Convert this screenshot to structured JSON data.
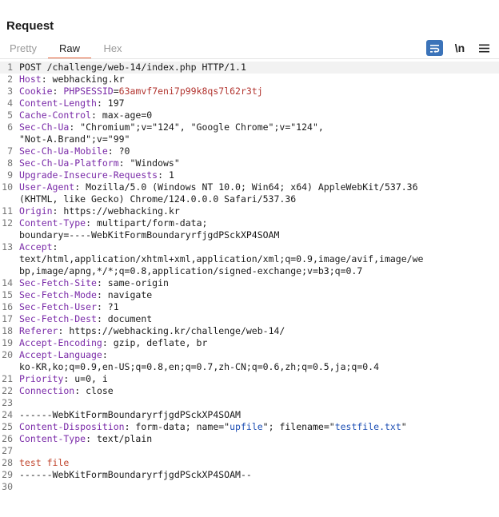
{
  "panel": {
    "title": "Request"
  },
  "tabs": [
    {
      "label": "Pretty",
      "active": false
    },
    {
      "label": "Raw",
      "active": true
    },
    {
      "label": "Hex",
      "active": false
    }
  ],
  "toolbar": {
    "newline_label": "\\n",
    "wrap_icon": "wrap-lines-icon",
    "menu_icon": "hamburger-menu-icon",
    "accent_color": "#3b73b9"
  },
  "colors": {
    "header_key": "#7a2aa8",
    "cookie_value": "#b2342f",
    "form_value": "#1e4fb4",
    "body_text": "#c1462e",
    "tab_underline": "#e8643a"
  },
  "editor": {
    "lines": [
      {
        "n": "1",
        "segs": [
          {
            "t": "POST /challenge/web-14/index.php HTTP/1.1",
            "k": "p"
          }
        ]
      },
      {
        "n": "2",
        "segs": [
          {
            "t": "Host",
            "k": "hk"
          },
          {
            "t": ": webhacking.kr",
            "k": "p"
          }
        ]
      },
      {
        "n": "3",
        "segs": [
          {
            "t": "Cookie",
            "k": "hk"
          },
          {
            "t": ": ",
            "k": "p"
          },
          {
            "t": "PHPSESSID",
            "k": "hk"
          },
          {
            "t": "=",
            "k": "p"
          },
          {
            "t": "63amvf7eni7p99k8qs7l62r3tj",
            "k": "rv"
          }
        ]
      },
      {
        "n": "4",
        "segs": [
          {
            "t": "Content-Length",
            "k": "hk"
          },
          {
            "t": ": 197",
            "k": "p"
          }
        ]
      },
      {
        "n": "5",
        "segs": [
          {
            "t": "Cache-Control",
            "k": "hk"
          },
          {
            "t": ": max-age=0",
            "k": "p"
          }
        ]
      },
      {
        "n": "6",
        "segs": [
          {
            "t": "Sec-Ch-Ua",
            "k": "hk"
          },
          {
            "t": ": \"Chromium\";v=\"124\", \"Google Chrome\";v=\"124\",",
            "k": "p"
          }
        ]
      },
      {
        "n": "",
        "segs": [
          {
            "t": "\"Not-A.Brand\";v=\"99\"",
            "k": "p"
          }
        ]
      },
      {
        "n": "7",
        "segs": [
          {
            "t": "Sec-Ch-Ua-Mobile",
            "k": "hk"
          },
          {
            "t": ": ?0",
            "k": "p"
          }
        ]
      },
      {
        "n": "8",
        "segs": [
          {
            "t": "Sec-Ch-Ua-Platform",
            "k": "hk"
          },
          {
            "t": ": \"Windows\"",
            "k": "p"
          }
        ]
      },
      {
        "n": "9",
        "segs": [
          {
            "t": "Upgrade-Insecure-Requests",
            "k": "hk"
          },
          {
            "t": ": 1",
            "k": "p"
          }
        ]
      },
      {
        "n": "10",
        "segs": [
          {
            "t": "User-Agent",
            "k": "hk"
          },
          {
            "t": ": Mozilla/5.0 (Windows NT 10.0; Win64; x64) AppleWebKit/537.36",
            "k": "p"
          }
        ]
      },
      {
        "n": "",
        "segs": [
          {
            "t": "(KHTML, like Gecko) Chrome/124.0.0.0 Safari/537.36",
            "k": "p"
          }
        ]
      },
      {
        "n": "11",
        "segs": [
          {
            "t": "Origin",
            "k": "hk"
          },
          {
            "t": ": https://webhacking.kr",
            "k": "p"
          }
        ]
      },
      {
        "n": "12",
        "segs": [
          {
            "t": "Content-Type",
            "k": "hk"
          },
          {
            "t": ": multipart/form-data;",
            "k": "p"
          }
        ]
      },
      {
        "n": "",
        "segs": [
          {
            "t": "boundary=----WebKitFormBoundaryrfjgdPSckXP4SOAM",
            "k": "p"
          }
        ]
      },
      {
        "n": "13",
        "segs": [
          {
            "t": "Accept",
            "k": "hk"
          },
          {
            "t": ":",
            "k": "p"
          }
        ]
      },
      {
        "n": "",
        "segs": [
          {
            "t": "text/html,application/xhtml+xml,application/xml;q=0.9,image/avif,image/we",
            "k": "p"
          }
        ]
      },
      {
        "n": "",
        "segs": [
          {
            "t": "bp,image/apng,*/*;q=0.8,application/signed-exchange;v=b3;q=0.7",
            "k": "p"
          }
        ]
      },
      {
        "n": "14",
        "segs": [
          {
            "t": "Sec-Fetch-Site",
            "k": "hk"
          },
          {
            "t": ": same-origin",
            "k": "p"
          }
        ]
      },
      {
        "n": "15",
        "segs": [
          {
            "t": "Sec-Fetch-Mode",
            "k": "hk"
          },
          {
            "t": ": navigate",
            "k": "p"
          }
        ]
      },
      {
        "n": "16",
        "segs": [
          {
            "t": "Sec-Fetch-User",
            "k": "hk"
          },
          {
            "t": ": ?1",
            "k": "p"
          }
        ]
      },
      {
        "n": "17",
        "segs": [
          {
            "t": "Sec-Fetch-Dest",
            "k": "hk"
          },
          {
            "t": ": document",
            "k": "p"
          }
        ]
      },
      {
        "n": "18",
        "segs": [
          {
            "t": "Referer",
            "k": "hk"
          },
          {
            "t": ": https://webhacking.kr/challenge/web-14/",
            "k": "p"
          }
        ]
      },
      {
        "n": "19",
        "segs": [
          {
            "t": "Accept-Encoding",
            "k": "hk"
          },
          {
            "t": ": gzip, deflate, br",
            "k": "p"
          }
        ]
      },
      {
        "n": "20",
        "segs": [
          {
            "t": "Accept-Language",
            "k": "hk"
          },
          {
            "t": ":",
            "k": "p"
          }
        ]
      },
      {
        "n": "",
        "segs": [
          {
            "t": "ko-KR,ko;q=0.9,en-US;q=0.8,en;q=0.7,zh-CN;q=0.6,zh;q=0.5,ja;q=0.4",
            "k": "p"
          }
        ]
      },
      {
        "n": "21",
        "segs": [
          {
            "t": "Priority",
            "k": "hk"
          },
          {
            "t": ": u=0, i",
            "k": "p"
          }
        ]
      },
      {
        "n": "22",
        "segs": [
          {
            "t": "Connection",
            "k": "hk"
          },
          {
            "t": ": close",
            "k": "p"
          }
        ]
      },
      {
        "n": "23",
        "segs": []
      },
      {
        "n": "24",
        "segs": [
          {
            "t": "------WebKitFormBoundaryrfjgdPSckXP4SOAM",
            "k": "p"
          }
        ]
      },
      {
        "n": "25",
        "segs": [
          {
            "t": "Content-Disposition",
            "k": "hk"
          },
          {
            "t": ": form-data; name=\"",
            "k": "p"
          },
          {
            "t": "upfile",
            "k": "bl"
          },
          {
            "t": "\"; filename=\"",
            "k": "p"
          },
          {
            "t": "testfile.txt",
            "k": "bl"
          },
          {
            "t": "\"",
            "k": "p"
          }
        ]
      },
      {
        "n": "26",
        "segs": [
          {
            "t": "Content-Type",
            "k": "hk"
          },
          {
            "t": ": text/plain",
            "k": "p"
          }
        ]
      },
      {
        "n": "27",
        "segs": []
      },
      {
        "n": "28",
        "segs": [
          {
            "t": "test file",
            "k": "or"
          }
        ]
      },
      {
        "n": "29",
        "segs": [
          {
            "t": "------WebKitFormBoundaryrfjgdPSckXP4SOAM--",
            "k": "p"
          }
        ]
      },
      {
        "n": "30",
        "segs": []
      }
    ]
  }
}
